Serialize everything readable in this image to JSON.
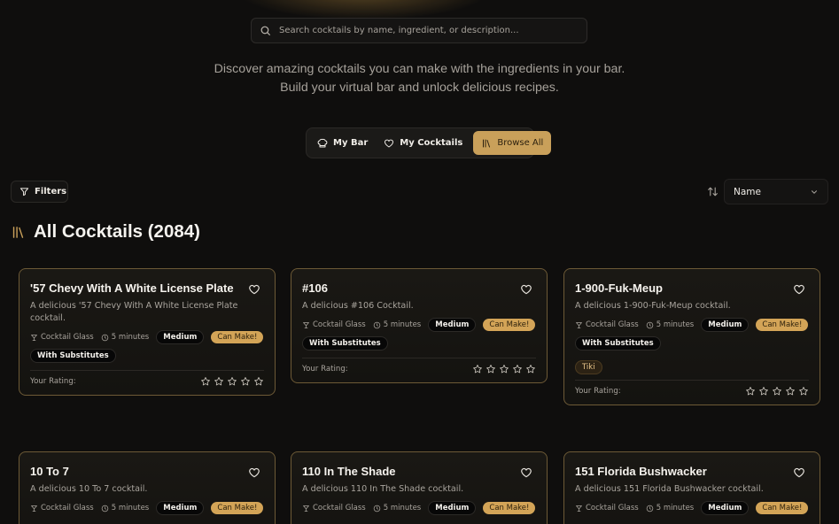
{
  "search": {
    "placeholder": "Search cocktails by name, ingredient, or description..."
  },
  "tagline": {
    "line1": "Discover amazing cocktails you can make with the ingredients in your bar.",
    "line2": "Build your virtual bar and unlock delicious recipes."
  },
  "tabs": [
    {
      "label": "My Bar",
      "icon": "chef-hat-icon",
      "active": false
    },
    {
      "label": "My Cocktails",
      "icon": "heart-icon",
      "active": false
    },
    {
      "label": "Browse All",
      "icon": "library-icon",
      "active": true
    }
  ],
  "toolbar": {
    "filters_label": "Filters",
    "sort_value": "Name"
  },
  "section": {
    "title": "All Cocktails (2084)",
    "icon": "library-icon"
  },
  "colors": {
    "accent": "#d3a457",
    "card_border": "#6d5a36",
    "background": "#0f0e0d"
  },
  "cards": [
    {
      "title": "'57 Chevy With A White License Plate",
      "description": "A delicious '57 Chevy With A White License Plate cocktail.",
      "glass": "Cocktail Glass",
      "time": "5 minutes",
      "difficulty": "Medium",
      "status": "Can Make!",
      "substitutes": "With Substitutes",
      "tag": "",
      "rating_label": "Your Rating:"
    },
    {
      "title": "#106",
      "description": "A delicious #106 Cocktail.",
      "glass": "Cocktail Glass",
      "time": "5 minutes",
      "difficulty": "Medium",
      "status": "Can Make!",
      "substitutes": "With Substitutes",
      "tag": "",
      "rating_label": "Your Rating:"
    },
    {
      "title": "1-900-Fuk-Meup",
      "description": "A delicious 1-900-Fuk-Meup cocktail.",
      "glass": "Cocktail Glass",
      "time": "5 minutes",
      "difficulty": "Medium",
      "status": "Can Make!",
      "substitutes": "With Substitutes",
      "tag": "Tiki",
      "rating_label": "Your Rating:"
    },
    {
      "title": "10 To 7",
      "description": "A delicious 10 To 7 cocktail.",
      "glass": "Cocktail Glass",
      "time": "5 minutes",
      "difficulty": "Medium",
      "status": "Can Make!",
      "substitutes": "",
      "tag": "",
      "rating_label": ""
    },
    {
      "title": "110 In The Shade",
      "description": "A delicious 110 In The Shade cocktail.",
      "glass": "Cocktail Glass",
      "time": "5 minutes",
      "difficulty": "Medium",
      "status": "Can Make!",
      "substitutes": "",
      "tag": "",
      "rating_label": ""
    },
    {
      "title": "151 Florida Bushwacker",
      "description": "A delicious 151 Florida Bushwacker cocktail.",
      "glass": "Cocktail Glass",
      "time": "5 minutes",
      "difficulty": "Medium",
      "status": "Can Make!",
      "substitutes": "",
      "tag": "",
      "rating_label": ""
    }
  ]
}
